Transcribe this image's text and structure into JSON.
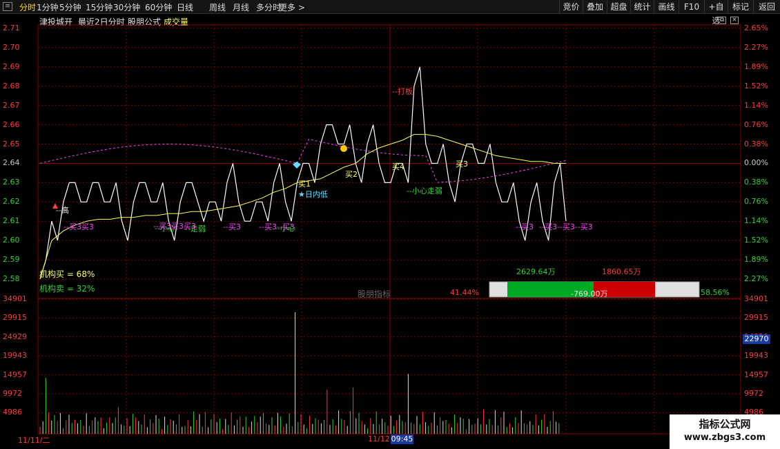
{
  "toolbar": {
    "periods": [
      "分时",
      "1分钟",
      "5分钟",
      "15分钟",
      "30分钟",
      "60分钟",
      "日线",
      "周线",
      "月线",
      "多分时",
      "更多"
    ],
    "right_buttons": [
      "竞价",
      "叠加",
      "超盘",
      "统计",
      "画线",
      "F10",
      "+自选",
      "标记",
      "返回"
    ]
  },
  "header": {
    "stock_name": "津投城开",
    "mode": "最近2日分时",
    "formula": "股朋公式",
    "volume_label": "成交量"
  },
  "price_axis": [
    "2.71",
    "2.70",
    "2.69",
    "2.68",
    "2.67",
    "2.66",
    "2.65",
    "2.64",
    "2.63",
    "2.62",
    "2.61",
    "2.60",
    "2.59",
    "2.58"
  ],
  "pct_axis": [
    "2.65%",
    "2.27%",
    "1.89%",
    "1.52%",
    "1.14%",
    "0.76%",
    "0.38%",
    "0.00%",
    "0.38%",
    "0.76%",
    "1.14%",
    "1.52%",
    "1.89%",
    "2.27%"
  ],
  "volume_axis": [
    "34901",
    "29915",
    "24929",
    "19943",
    "14957",
    "9972",
    "4986"
  ],
  "volume_axis_right": [
    "34901",
    "29915",
    "24929",
    "19943",
    "14957",
    "9972",
    "4986"
  ],
  "cursor_volume": "22970",
  "dates": {
    "day1": "11/11/二",
    "day2": "11/12",
    "cursor_time": "09:45"
  },
  "annotations": {
    "jigou_buy": "机构买 = 68%",
    "jigou_sell": "机构卖 = 32%",
    "gupeng_label": "股朋指标",
    "pct_left": "41.44%",
    "pct_right": "58.56%",
    "buy_amount": "2629.64万",
    "sell_amount": "1860.65万",
    "net_amount": "-769.00万",
    "da_ban": "--打板",
    "ri_nei_di": "★日内低",
    "buy2": "买2",
    "buy1": "买1",
    "buy4": "买4",
    "buy3_label": "买3",
    "buy3_label_b": "买3",
    "xiao_xin_qu_ruo": "--小心走弱",
    "xiao_xin": "--小心",
    "zou_ruo": "--走弱",
    "mai3_seq1": "--买3买3",
    "mai3_seq2": "--买3买3买3",
    "mai3_seq3": "--买3",
    "mai3_seq4": "--买3--买3",
    "mai3_seq5": "--买3",
    "mai3_seq6": "--买3--买3--买3",
    "gao_label": "--高",
    "wan_label": "--晚",
    "xiao_qu_ruo": "--小心走弱"
  },
  "watermark": {
    "line1": "指标公式网",
    "line2": "www.zbgs3.com"
  },
  "chart_data": {
    "type": "line",
    "title": "津投城开",
    "series": [
      {
        "name": "price",
        "values": [
          2.58,
          2.61,
          2.62,
          2.63,
          2.62,
          2.63,
          2.62,
          2.61,
          2.62,
          2.63,
          2.62,
          2.61,
          2.62,
          2.63,
          2.61,
          2.62,
          2.63,
          2.62,
          2.61,
          2.62,
          2.63,
          2.62,
          2.63,
          2.64,
          2.65,
          2.66,
          2.65,
          2.64,
          2.65,
          2.64,
          2.63,
          2.64,
          2.68,
          2.65,
          2.64,
          2.63,
          2.64,
          2.65,
          2.64,
          2.63,
          2.62,
          2.61,
          2.62,
          2.61,
          2.63,
          2.61
        ]
      },
      {
        "name": "avg",
        "values": [
          2.58,
          2.6,
          2.605,
          2.608,
          2.61,
          2.611,
          2.611,
          2.612,
          2.612,
          2.613,
          2.613,
          2.614,
          2.614,
          2.615,
          2.615,
          2.616,
          2.617,
          2.618,
          2.62,
          2.622,
          2.625,
          2.627,
          2.63,
          2.631,
          2.632,
          2.635,
          2.638,
          2.64,
          2.645,
          2.648,
          2.65,
          2.652,
          2.655,
          2.655,
          2.654,
          2.652,
          2.65,
          2.648,
          2.646,
          2.644,
          2.643,
          2.642,
          2.641,
          2.641,
          2.64,
          2.64
        ]
      }
    ],
    "ylim": [
      2.58,
      2.71
    ],
    "volume": {
      "ylim": [
        0,
        34901
      ]
    },
    "indicator": {
      "buy_pct": 41.44,
      "sell_pct": 58.56
    }
  }
}
